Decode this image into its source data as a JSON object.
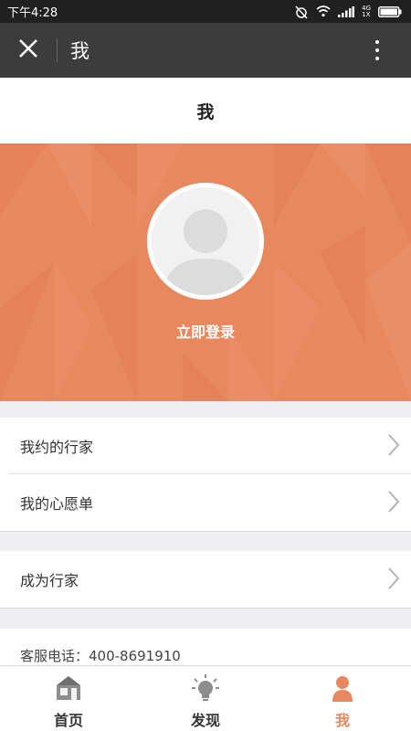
{
  "status_bar": {
    "time": "下午4:28",
    "network_type": "4G",
    "sim": "1X"
  },
  "app_bar": {
    "title": "我"
  },
  "page": {
    "title": "我"
  },
  "profile": {
    "login_label": "立即登录",
    "banner_color": "#e8885f"
  },
  "menu_group_1": {
    "items": [
      {
        "label": "我约的行家"
      },
      {
        "label": "我的心愿单"
      }
    ]
  },
  "menu_group_2": {
    "items": [
      {
        "label": "成为行家"
      }
    ]
  },
  "service": {
    "text": "客服电话：400-8691910"
  },
  "tab_bar": {
    "active_color": "#e8885f",
    "tabs": [
      {
        "label": "首页",
        "icon": "home-icon"
      },
      {
        "label": "发现",
        "icon": "lightbulb-icon"
      },
      {
        "label": "我",
        "icon": "person-icon",
        "active": true
      }
    ]
  }
}
